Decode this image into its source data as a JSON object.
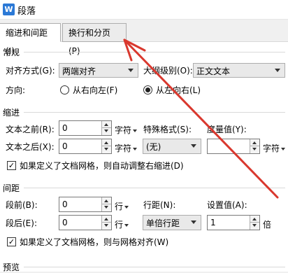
{
  "window": {
    "title": "段落",
    "icon_letter": "W"
  },
  "tabs": [
    {
      "label": "缩进和间距(I)",
      "active": true
    },
    {
      "label": "换行和分页(P)",
      "active": false
    }
  ],
  "general": {
    "heading": "常规",
    "alignment_label": "对齐方式(G):",
    "alignment_value": "两端对齐",
    "outline_label": "大纲级别(O):",
    "outline_value": "正文文本",
    "direction_label": "方向:",
    "rtl_label": "从右向左(F)",
    "ltr_label": "从左向右(L)",
    "direction_selected": "ltr"
  },
  "indent": {
    "heading": "缩进",
    "before_label": "文本之前(R):",
    "before_value": "0",
    "before_unit": "字符",
    "after_label": "文本之后(X):",
    "after_value": "0",
    "after_unit": "字符",
    "special_label": "特殊格式(S):",
    "special_value": "(无)",
    "measure_label": "度量值(Y):",
    "measure_value": "",
    "measure_unit": "字符",
    "auto_adjust_label": "如果定义了文档网格，则自动调整右缩进(D)",
    "auto_adjust_checked": true
  },
  "spacing": {
    "heading": "间距",
    "before_label": "段前(B):",
    "before_value": "0",
    "before_unit": "行",
    "after_label": "段后(E):",
    "after_value": "0",
    "after_unit": "行",
    "line_label": "行距(N):",
    "line_value": "单倍行距",
    "setting_label": "设置值(A):",
    "setting_value": "1",
    "setting_unit": "倍",
    "snap_grid_label": "如果定义了文档网格，则与网格对齐(W)",
    "snap_grid_checked": true
  },
  "preview": {
    "heading": "预览"
  },
  "annotation": {
    "color": "#d9382e"
  }
}
